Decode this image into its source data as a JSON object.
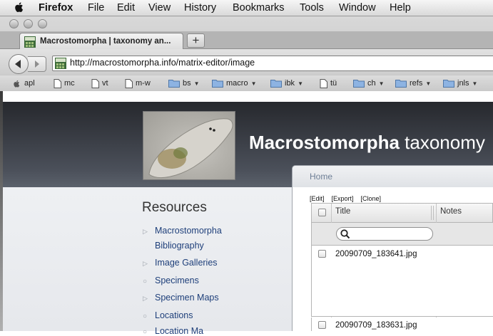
{
  "menubar": {
    "app": "Firefox",
    "items": [
      "File",
      "Edit",
      "View",
      "History",
      "Bookmarks",
      "Tools",
      "Window",
      "Help"
    ]
  },
  "tab": {
    "title": "Macrostomorpha | taxonomy an..."
  },
  "newtab_label": "+",
  "urlbar": {
    "url": "http://macrostomorpha.info/matrix-editor/image"
  },
  "bookmarks": [
    {
      "label": "apl",
      "icon": "apple-icon"
    },
    {
      "label": "mc",
      "icon": "page-icon"
    },
    {
      "label": "vt",
      "icon": "page-icon"
    },
    {
      "label": "m-w",
      "icon": "page-icon"
    },
    {
      "label": "bs",
      "icon": "folder-icon"
    },
    {
      "label": "macro",
      "icon": "folder-icon"
    },
    {
      "label": "ibk",
      "icon": "folder-icon"
    },
    {
      "label": "tü",
      "icon": "page-icon"
    },
    {
      "label": "ch",
      "icon": "folder-icon"
    },
    {
      "label": "refs",
      "icon": "folder-icon"
    },
    {
      "label": "jnls",
      "icon": "folder-icon"
    }
  ],
  "site": {
    "title_bold": "Macrostomorpha",
    "title_rest": " taxonomy"
  },
  "sidebar": {
    "title": "Resources",
    "items": [
      {
        "label1": "Macrostomorpha",
        "label2": "Bibliography"
      },
      {
        "label1": "Image Galleries"
      },
      {
        "label1": "Specimens"
      },
      {
        "label1": "Specimen Maps"
      },
      {
        "label1": "Locations"
      },
      {
        "label1": "Location Ma"
      }
    ]
  },
  "matrix": {
    "breadcrumb": "Home",
    "actions": [
      "[Edit]",
      "[Export]",
      "[Clone]"
    ],
    "columns": [
      "Title",
      "Notes"
    ],
    "rows": [
      "20090709_183641.jpg",
      "20090709_183631.jpg"
    ]
  },
  "colors": {
    "link": "#1e3f7a",
    "header_bg": "#2f3238",
    "sidebar_bg": "#eceef1"
  }
}
